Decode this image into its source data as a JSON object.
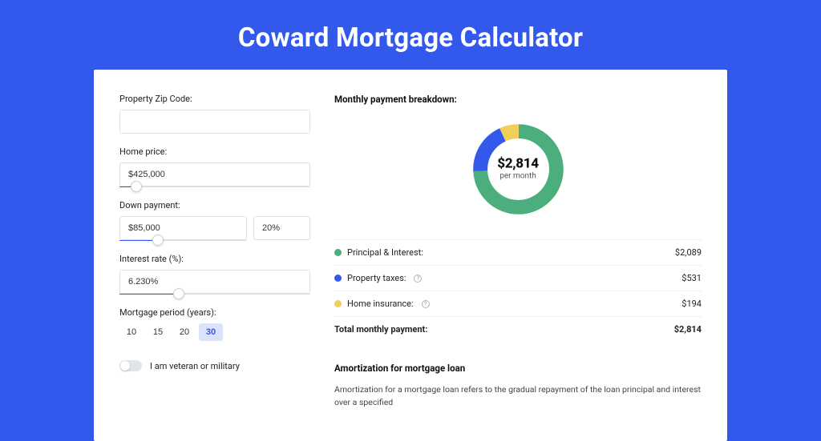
{
  "title": "Coward Mortgage Calculator",
  "form": {
    "zip_label": "Property Zip Code:",
    "zip_value": "",
    "home_price_label": "Home price:",
    "home_price_value": "$425,000",
    "down_payment_label": "Down payment:",
    "down_payment_amount": "$85,000",
    "down_payment_percent": "20%",
    "interest_label": "Interest rate (%):",
    "interest_value": "6.230%",
    "period_label": "Mortgage period (years):",
    "periods": [
      "10",
      "15",
      "20",
      "30"
    ],
    "period_active_index": 3,
    "veteran_label": "I am veteran or military"
  },
  "breakdown": {
    "title": "Monthly payment breakdown:",
    "total_amount": "$2,814",
    "per_month": "per month",
    "rows": [
      {
        "label": "Principal & Interest:",
        "value": "$2,089",
        "color": "green",
        "info": false
      },
      {
        "label": "Property taxes:",
        "value": "$531",
        "color": "blue",
        "info": true
      },
      {
        "label": "Home insurance:",
        "value": "$194",
        "color": "yellow",
        "info": true
      }
    ],
    "total_label": "Total monthly payment:",
    "total_value": "$2,814"
  },
  "amortization": {
    "title": "Amortization for mortgage loan",
    "text": "Amortization for a mortgage loan refers to the gradual repayment of the loan principal and interest over a specified"
  },
  "chart_data": {
    "type": "pie",
    "title": "Monthly payment breakdown",
    "series": [
      {
        "name": "Principal & Interest",
        "value": 2089,
        "color": "#4cae7d"
      },
      {
        "name": "Property taxes",
        "value": 531,
        "color": "#3358ec"
      },
      {
        "name": "Home insurance",
        "value": 194,
        "color": "#f2ce5a"
      }
    ],
    "total": 2814,
    "center_label": "$2,814 per month"
  }
}
